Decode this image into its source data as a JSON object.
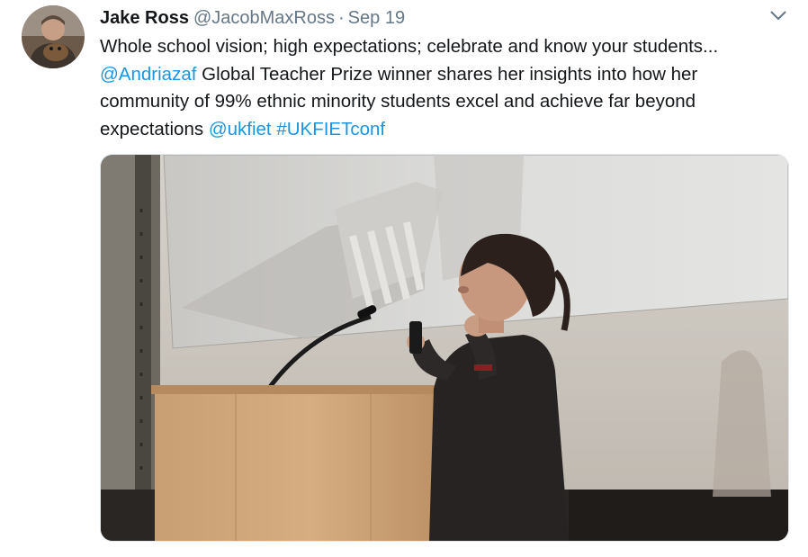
{
  "tweet": {
    "author": {
      "name": "Jake Ross",
      "handle": "@JacobMaxRoss",
      "separator": "·",
      "time": "Sep 19"
    },
    "text": {
      "line1": "Whole school vision; high expectations; celebrate and know your students...",
      "mention_andriazaf": "@Andriazaf",
      "line2_rest": " Global Teacher Prize winner shares her insights into how her",
      "line3": "community of 99% ethnic minority students excel and achieve far beyond",
      "line4_start": "expectations ",
      "mention_ukfiet": "@ukfiet",
      "space": " ",
      "hashtag": "#UKFIETconf"
    },
    "icons": {
      "more": "chevron-down-icon"
    }
  },
  "colors": {
    "link": "#1b95e0",
    "secondary_text": "#657786",
    "primary_text": "#14171a"
  }
}
